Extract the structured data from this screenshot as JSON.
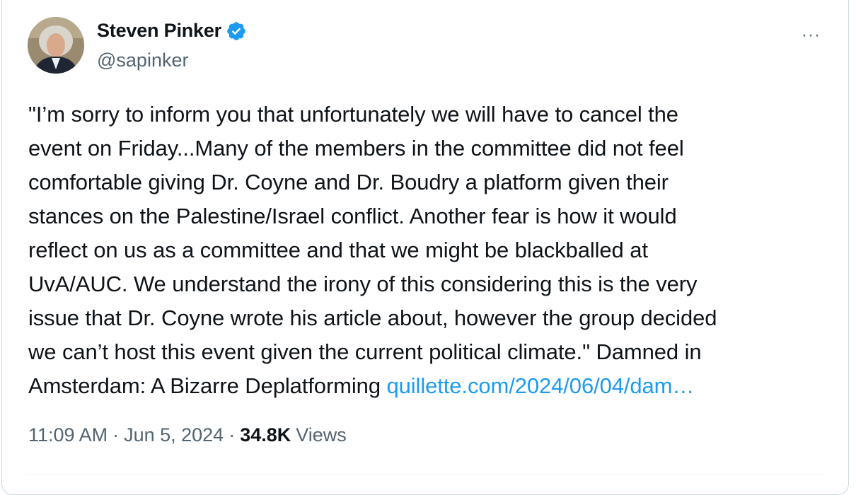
{
  "author": {
    "name": "Steven Pinker",
    "handle": "@sapinker",
    "verified_icon": "verified-badge-icon",
    "avatar_icon": "profile-photo"
  },
  "tweet": {
    "text_line1": "\"I’m sorry to inform you that unfortunately we will have to cancel the",
    "text_line2": "event on Friday...Many of the members in the committee did not feel",
    "text_line3": "comfortable giving Dr. Coyne and Dr. Boudry a platform given their",
    "text_line4": "stances on the Palestine/Israel conflict. Another fear is how it would",
    "text_line5": "reflect on us as a committee and that we might be blackballed at",
    "text_line6": "UvA/AUC. We understand the irony of this considering this is the very",
    "text_line7": "issue that Dr. Coyne wrote his article about, however the group decided",
    "text_line8": "we can’t host this event given the current political climate.\"  Damned in",
    "text_line9": "Amsterdam: A Bizarre Deplatforming ",
    "link_text": "quillette.com/2024/06/04/dam…"
  },
  "meta": {
    "time": "11:09 AM",
    "separator": "·",
    "date": "Jun 5, 2024",
    "views_count": "34.8K",
    "views_label": "Views"
  },
  "menu": {
    "more_label": "···"
  },
  "colors": {
    "accent": "#1d9bf0",
    "text": "#0f1419",
    "secondary": "#536471",
    "border": "#cfd9de"
  }
}
